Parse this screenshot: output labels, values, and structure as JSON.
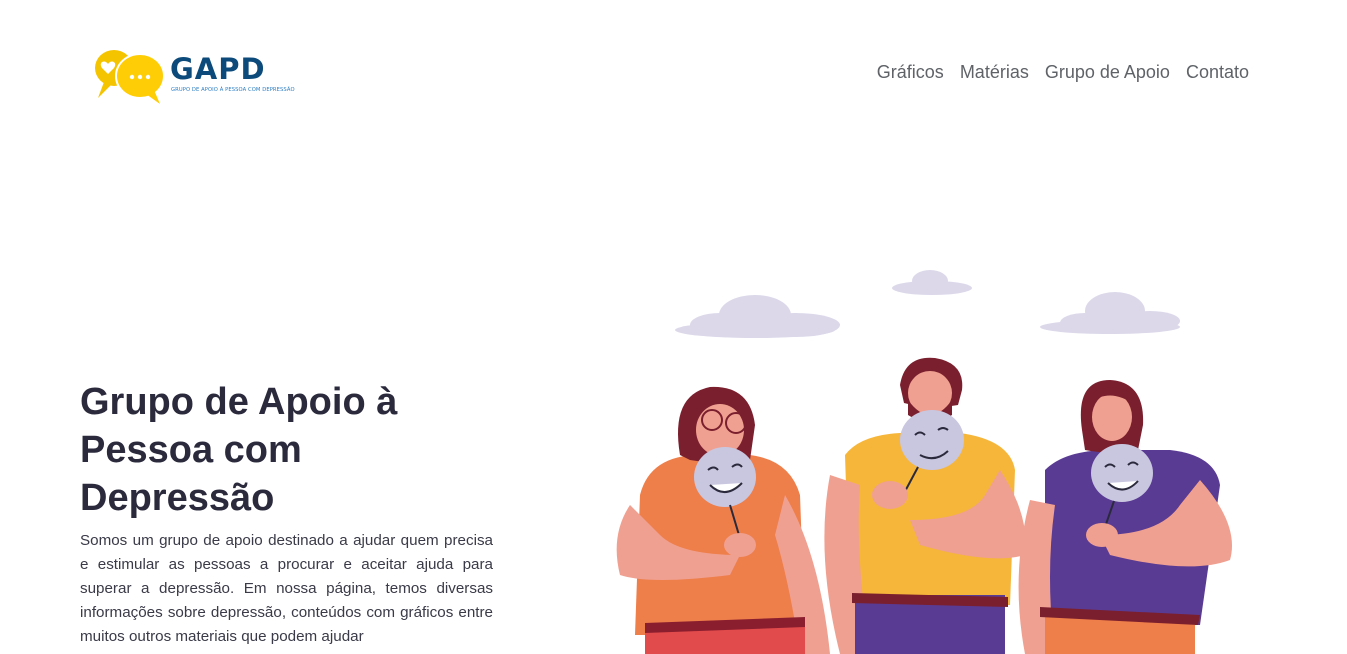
{
  "brand": {
    "name": "GAPD",
    "subtitle": "GRUPO DE APOIO À PESSOA COM DEPRESSÃO",
    "colors": {
      "primary": "#0b4a7a",
      "accent": "#f5c400",
      "subtitle": "#2c7dc2"
    },
    "icon": "chat-bubbles-heart-icon"
  },
  "nav": {
    "items": [
      {
        "label": "Gráficos"
      },
      {
        "label": "Matérias"
      },
      {
        "label": "Grupo de Apoio"
      },
      {
        "label": "Contato"
      }
    ]
  },
  "hero": {
    "title": "Grupo de Apoio à Pessoa com Depressão",
    "description": "Somos um grupo de apoio destinado a ajudar quem precisa e estimular as pessoas a procurar e aceitar ajuda para superar a depressão. Em nossa página, temos diversas informações sobre depressão, conteúdos com gráficos entre muitos outros materiais que podem ajudar"
  },
  "illustration": {
    "description_icon": "three-people-holding-smiling-masks-illustration"
  }
}
